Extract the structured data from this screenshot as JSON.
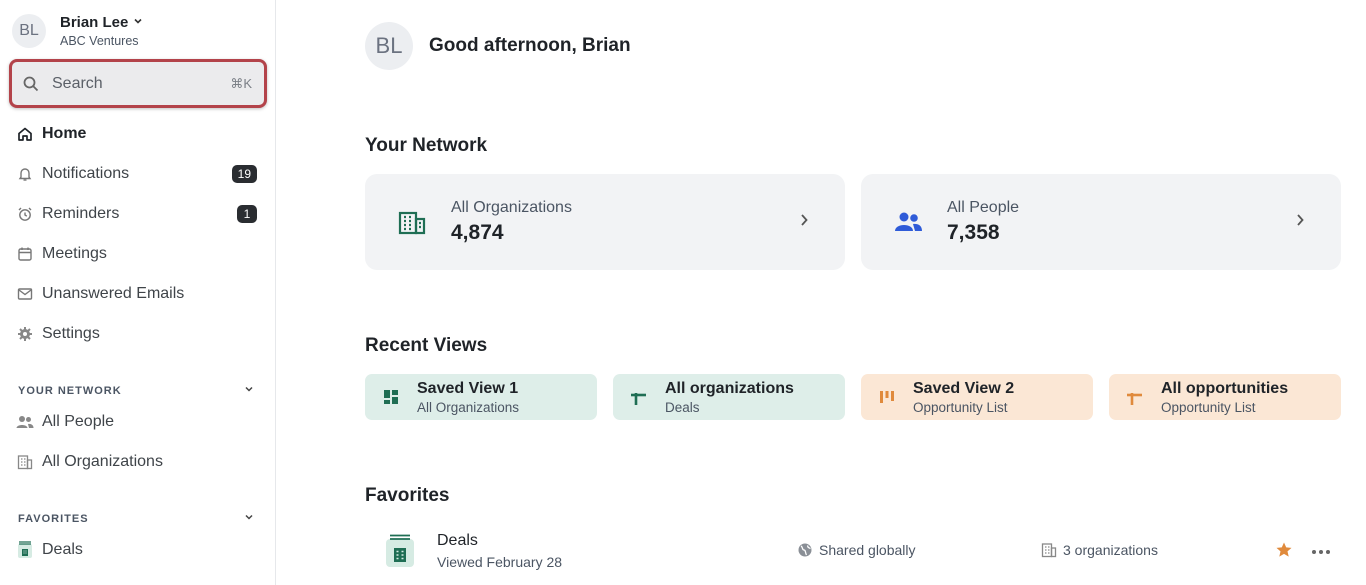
{
  "account": {
    "initials": "BL",
    "name": "Brian Lee",
    "org": "ABC Ventures"
  },
  "search": {
    "placeholder": "Search",
    "shortcut": "⌘K"
  },
  "nav": {
    "home": "Home",
    "notifications": "Notifications",
    "notifications_count": "19",
    "reminders": "Reminders",
    "reminders_count": "1",
    "meetings": "Meetings",
    "unanswered_emails": "Unanswered Emails",
    "settings": "Settings"
  },
  "your_network_section": {
    "heading": "YOUR NETWORK",
    "people": "All People",
    "organizations": "All Organizations"
  },
  "favorites_section": {
    "heading": "FAVORITES",
    "deals": "Deals"
  },
  "main": {
    "initials": "BL",
    "greeting": "Good afternoon, Brian",
    "network_title": "Your Network",
    "network_cards": [
      {
        "label": "All Organizations",
        "count": "4,874"
      },
      {
        "label": "All People",
        "count": "7,358"
      }
    ],
    "recent_title": "Recent Views",
    "recent_views": [
      {
        "title": "Saved View 1",
        "subtitle": "All Organizations"
      },
      {
        "title": "All organizations",
        "subtitle": "Deals"
      },
      {
        "title": "Saved View 2",
        "subtitle": "Opportunity List"
      },
      {
        "title": "All opportunities",
        "subtitle": "Opportunity List"
      }
    ],
    "favorites_title": "Favorites",
    "favorites": [
      {
        "title": "Deals",
        "subtitle": "Viewed February 28",
        "shared": "Shared globally",
        "orgs": "3 organizations"
      }
    ]
  },
  "icons": {
    "search": "search-icon",
    "home": "home-icon",
    "bell": "bell-icon",
    "alarm": "alarm-clock-icon",
    "calendar": "calendar-icon",
    "mail": "mail-icon",
    "gear": "gear-icon",
    "people": "people-icon",
    "building": "building-icon",
    "globe": "globe-icon",
    "star": "star-icon",
    "more": "more-icon"
  },
  "colors": {
    "accent_green": "#1f6e54",
    "accent_blue": "#2f5bd8",
    "accent_orange": "#e08a3c",
    "search_highlight": "#b3434a"
  }
}
